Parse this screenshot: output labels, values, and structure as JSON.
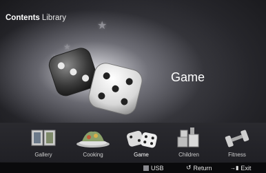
{
  "header": {
    "title_bold": "Contents",
    "title_rest": "Library"
  },
  "hero": {
    "selected_label": "Game"
  },
  "categories": [
    {
      "label": "Gallery",
      "icon": "gallery-icon"
    },
    {
      "label": "Cooking",
      "icon": "cooking-icon"
    },
    {
      "label": "Game",
      "icon": "dice-icon",
      "active": true
    },
    {
      "label": "Children",
      "icon": "children-icon"
    },
    {
      "label": "Fitness",
      "icon": "dumbbell-icon"
    }
  ],
  "status": {
    "usb_label": "USB",
    "return_label": "Return",
    "exit_label": "Exit",
    "return_glyph": "↺",
    "exit_glyph": "→▮"
  }
}
